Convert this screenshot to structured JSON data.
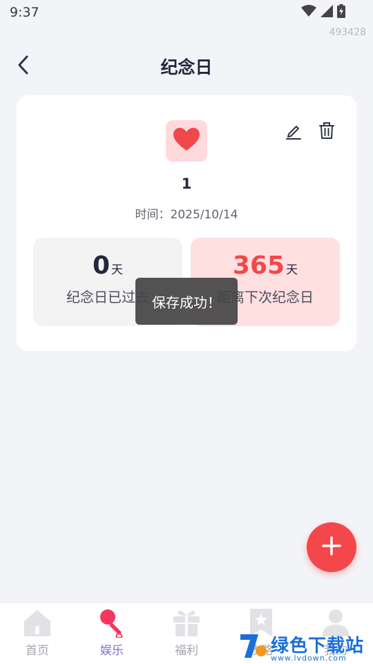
{
  "status_bar": {
    "time": "9:37",
    "icons": [
      "wifi-icon",
      "signal-icon",
      "battery-charging-icon"
    ]
  },
  "device_id": "493428",
  "header": {
    "title": "纪念日",
    "back_icon": "chevron-left-icon"
  },
  "card": {
    "icon": "heart-icon",
    "name": "1",
    "date_text": "时间：2025/10/14",
    "actions": {
      "edit_icon": "pencil-icon",
      "delete_icon": "trash-icon"
    },
    "stats": [
      {
        "value": "0",
        "unit": "天",
        "label": "纪念日已过去"
      },
      {
        "value": "365",
        "unit": "天",
        "label": "距离下次纪念日"
      }
    ]
  },
  "toast": {
    "message": "保存成功！"
  },
  "fab": {
    "icon": "plus-icon"
  },
  "bottom_nav": {
    "items": [
      {
        "label": "首页",
        "icon": "home-icon",
        "active": false
      },
      {
        "label": "娱乐",
        "icon": "microphone-icon",
        "active": true
      },
      {
        "label": "福利",
        "icon": "gift-icon",
        "active": false
      },
      {
        "label": "攻略",
        "icon": "bookmark-star-icon",
        "active": false
      },
      {
        "label": "我的",
        "icon": "user-icon",
        "active": false
      }
    ]
  },
  "watermark": {
    "title": "绿色下载站",
    "subtitle": "www.lvdown.com"
  },
  "colors": {
    "background": "#f3f4f8",
    "accent_red": "#f4474b",
    "heart_red": "#f0484b",
    "heart_bg": "#ffd9dc",
    "active_nav": "#7b70d6",
    "inactive_nav": "#a3a5ae"
  }
}
